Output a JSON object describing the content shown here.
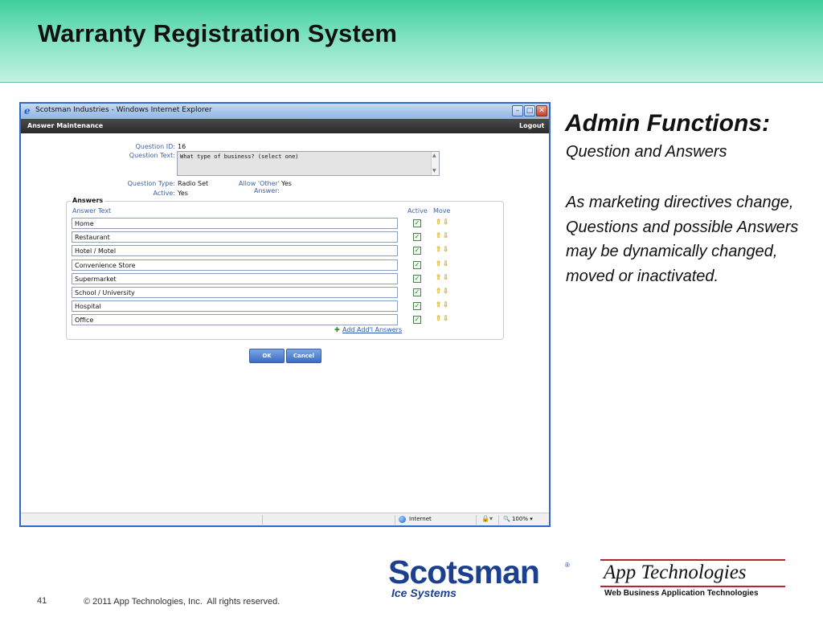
{
  "slide": {
    "title": "Warranty Registration System",
    "number": "41",
    "copyright": "© 2011 App Technologies, Inc.  All rights reserved."
  },
  "browser": {
    "window_title": "Scotsman Industries - Windows Internet Explorer",
    "app_header": "Answer Maintenance",
    "logout_label": "Logout",
    "status_zone": "Internet",
    "zoom": "100%"
  },
  "form": {
    "question_id_label": "Question ID:",
    "question_id": "16",
    "question_text_label": "Question Text:",
    "question_text": "What type of business? (select one)",
    "question_type_label": "Question Type:",
    "question_type": "Radio Set",
    "allow_other_label": "Allow 'Other' Answer:",
    "allow_other": "Yes",
    "active_label": "Active:",
    "active": "Yes"
  },
  "answers": {
    "legend": "Answers",
    "col_text": "Answer Text",
    "col_active": "Active",
    "col_move": "Move",
    "items": [
      {
        "text": "Home",
        "active": true
      },
      {
        "text": "Restaurant",
        "active": true
      },
      {
        "text": "Hotel / Motel",
        "active": true
      },
      {
        "text": "Convenience Store",
        "active": true
      },
      {
        "text": "Supermarket",
        "active": true
      },
      {
        "text": "School / University",
        "active": true
      },
      {
        "text": "Hospital",
        "active": true
      },
      {
        "text": "Office",
        "active": true
      }
    ],
    "add_link": "Add Add'l Answers"
  },
  "buttons": {
    "ok": "OK",
    "cancel": "Cancel"
  },
  "side": {
    "heading": "Admin Functions:",
    "subheading": "Question and Answers",
    "paragraph": "As marketing directives change, Questions and possible Answers may be dynamically changed, moved or inactivated."
  },
  "logos": {
    "scotsman": "Scotsman",
    "scotsman_reg": "®",
    "scotsman_sub": "Ice Systems",
    "apptech": "App  Technologies",
    "apptech_tag": "Web Business Application Technologies"
  },
  "colors": {
    "header_green": "#3fcf9d",
    "browser_border": "#2f69c6",
    "app_bar": "#2a2a2a",
    "label_blue": "#3f62a5",
    "scotsman_blue": "#1d3f8f",
    "apptech_red": "#b3262f"
  }
}
